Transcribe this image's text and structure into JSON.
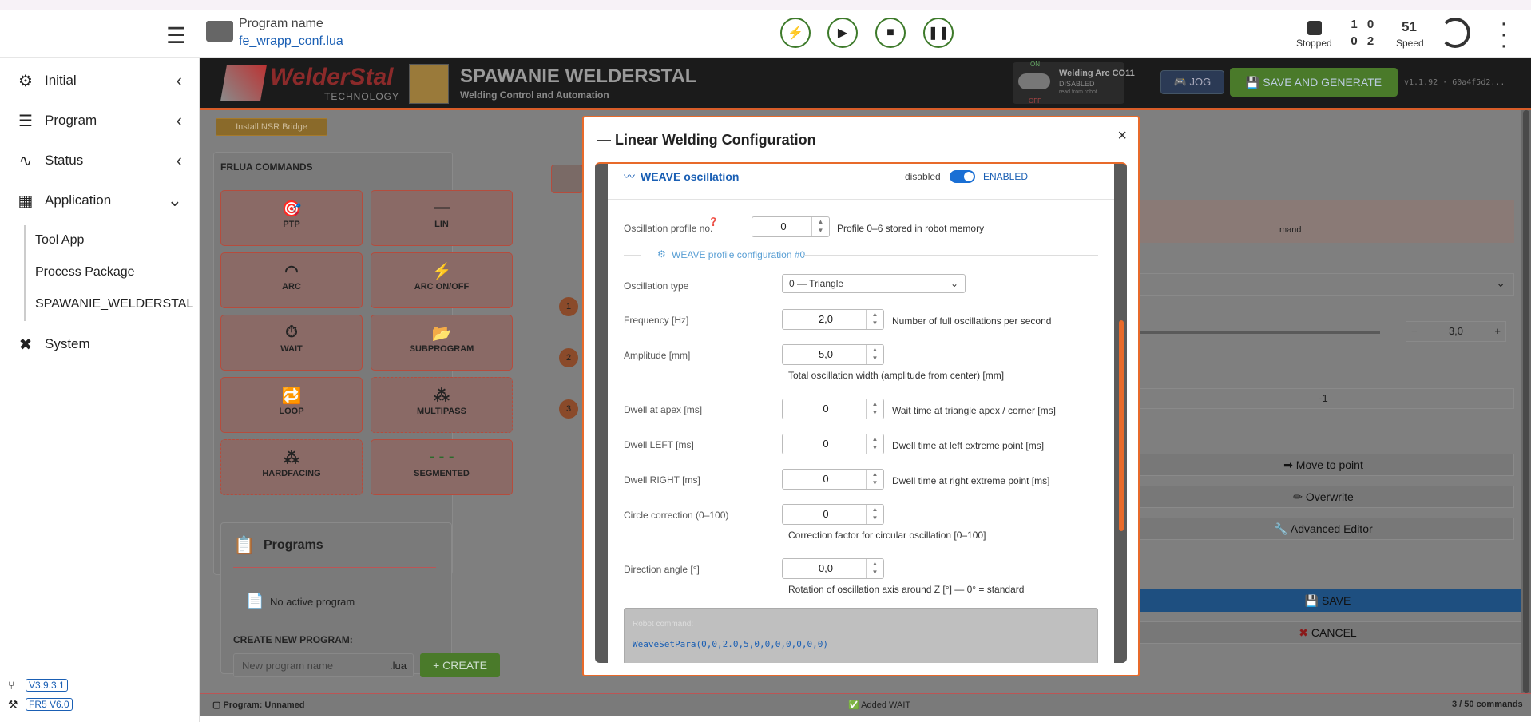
{
  "topbar": {
    "program_name_label": "Program name",
    "program_file": "fe_wrapp_conf.lua",
    "status_label": "Stopped",
    "counter": [
      "1",
      "0",
      "0",
      "2"
    ],
    "speed_value": "51",
    "speed_label": "Speed"
  },
  "sidebar": {
    "items": [
      {
        "label": "Initial"
      },
      {
        "label": "Program"
      },
      {
        "label": "Status"
      },
      {
        "label": "Application"
      }
    ],
    "subitems": [
      "Tool App",
      "Process Package",
      "SPAWANIE_WELDERSTAL"
    ],
    "system": "System",
    "version1": "V3.9.3.1",
    "version2": "FR5 V6.0"
  },
  "header": {
    "logo": "WelderStal",
    "logo_sub": "TECHNOLOGY",
    "title": "SPAWANIE WELDERSTAL",
    "subtitle": "Welding Control and Automation",
    "toggle_on": "ON",
    "toggle_off": "OFF",
    "arc_label": "Welding Arc CO11",
    "arc_state": "DISABLED",
    "arc_sub": "read from robot",
    "jog": "JOG",
    "save_generate": "SAVE AND GENERATE",
    "version": "v1.1.92 · 60a4f5d2..."
  },
  "bridge_button": "Install NSR Bridge",
  "commands": {
    "title": "FRLUA COMMANDS",
    "items": [
      "PTP",
      "LIN",
      "ARC",
      "ARC ON/OFF",
      "WAIT",
      "SUBPROGRAM",
      "LOOP",
      "MULTIPASS",
      "HARDFACING",
      "SEGMENTED"
    ]
  },
  "programs": {
    "title": "Programs",
    "empty": "No active program",
    "create_label": "CREATE NEW PROGRAM:",
    "placeholder": "New program name",
    "ext": ".lua",
    "create_button": "+ CREATE"
  },
  "footer": {
    "program": "Program: Unnamed",
    "added": "Added WAIT",
    "commands": "3 / 50 commands"
  },
  "right": {
    "mand": "mand",
    "stepper_value": "3,0",
    "field_value": "-1",
    "move": "Move to point",
    "overwrite": "Overwrite",
    "advanced": "Advanced Editor",
    "save": "SAVE",
    "cancel": "CANCEL"
  },
  "modal": {
    "title": "— Linear Welding Configuration",
    "close": "×",
    "section": "WEAVE oscillation",
    "disabled": "disabled",
    "enabled": "ENABLED",
    "profile_label": "Oscillation profile no.",
    "profile_value": "0",
    "profile_hint": "Profile 0–6 stored in robot memory",
    "config_title": "WEAVE profile configuration #0",
    "type_label": "Oscillation type",
    "type_value": "0 — Triangle",
    "freq_label": "Frequency [Hz]",
    "freq_value": "2,0",
    "freq_hint": "Number of full oscillations per second",
    "amp_label": "Amplitude [mm]",
    "amp_value": "5,0",
    "amp_hint": "Total oscillation width (amplitude from center) [mm]",
    "dwell_apex_label": "Dwell at apex [ms]",
    "dwell_apex_value": "0",
    "dwell_apex_hint": "Wait time at triangle apex / corner [ms]",
    "dwell_left_label": "Dwell LEFT [ms]",
    "dwell_left_value": "0",
    "dwell_left_hint": "Dwell time at left extreme point [ms]",
    "dwell_right_label": "Dwell RIGHT [ms]",
    "dwell_right_value": "0",
    "dwell_right_hint": "Dwell time at right extreme point [ms]",
    "circle_label": "Circle correction (0–100)",
    "circle_value": "0",
    "circle_hint": "Correction factor for circular oscillation [0–100]",
    "dir_label": "Direction angle [°]",
    "dir_value": "0,0",
    "dir_hint": "Rotation of oscillation axis around Z [°] — 0° = standard",
    "robot_cmd_label": "Robot command:",
    "robot_cmd": "WeaveSetPara(0,0,2.0,5,0,0,0,0,0,0,0)"
  }
}
